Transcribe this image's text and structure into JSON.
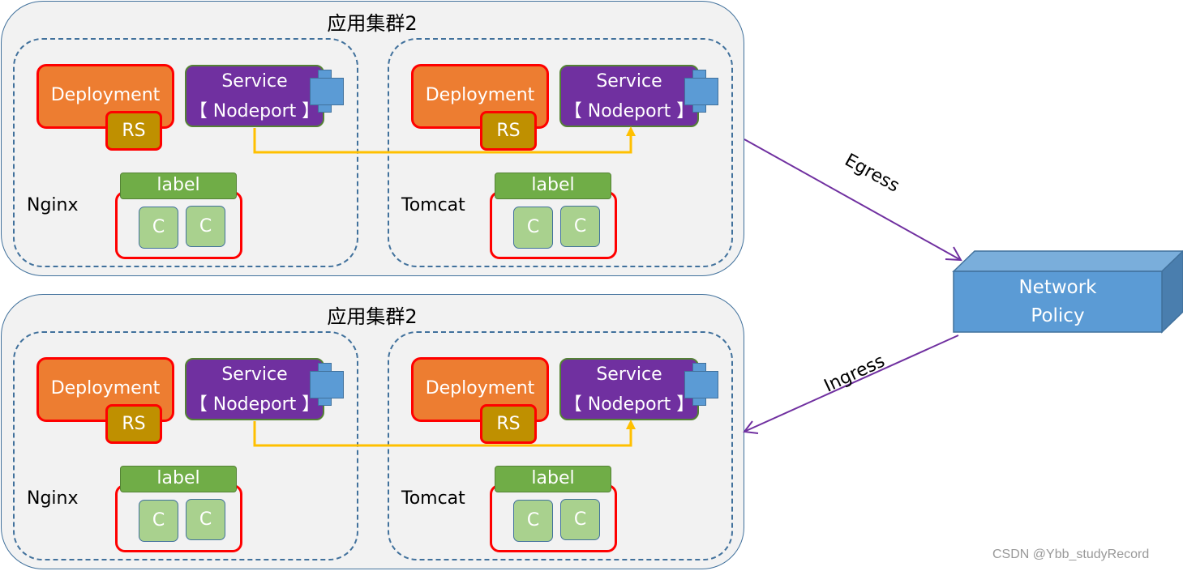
{
  "clusters": [
    {
      "title": "应用集群2",
      "apps": [
        {
          "name": "Nginx",
          "deployment": "Deployment",
          "rs": "RS",
          "service_line1": "Service",
          "service_line2": "【 Nodeport 】",
          "label": "label",
          "containers": [
            "C",
            "C"
          ]
        },
        {
          "name": "Tomcat",
          "deployment": "Deployment",
          "rs": "RS",
          "service_line1": "Service",
          "service_line2": "【 Nodeport 】",
          "label": "label",
          "containers": [
            "C",
            "C"
          ]
        }
      ]
    },
    {
      "title": "应用集群2",
      "apps": [
        {
          "name": "Nginx",
          "deployment": "Deployment",
          "rs": "RS",
          "service_line1": "Service",
          "service_line2": "【 Nodeport 】",
          "label": "label",
          "containers": [
            "C",
            "C"
          ]
        },
        {
          "name": "Tomcat",
          "deployment": "Deployment",
          "rs": "RS",
          "service_line1": "Service",
          "service_line2": "【 Nodeport 】",
          "label": "label",
          "containers": [
            "C",
            "C"
          ]
        }
      ]
    }
  ],
  "network_policy": {
    "line1": "Network",
    "line2": "Policy"
  },
  "edges": {
    "egress": "Egress",
    "ingress": "Ingress"
  },
  "colors": {
    "cluster_fill": "#f2f2f2",
    "cluster_border": "#41719c",
    "deployment": "#ed7d31",
    "rs": "#bf9000",
    "highlight_border": "#ff0000",
    "service": "#7030a0",
    "port": "#5b9bd5",
    "label": "#70ad47",
    "container": "#a9d18e",
    "connector": "#ffc000",
    "policy_arrow": "#7030a0",
    "network_policy": "#5b9bd5"
  },
  "watermark": "CSDN @Ybb_studyRecord"
}
